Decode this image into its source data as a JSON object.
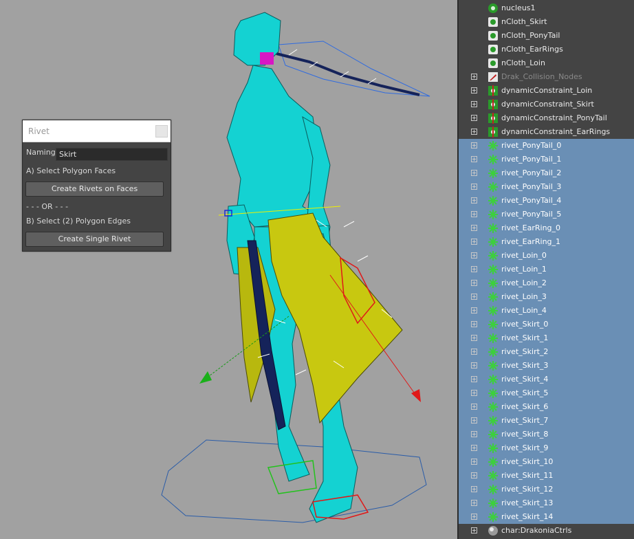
{
  "rivet_dialog": {
    "title": "Rivet",
    "naming_label": "Naming:",
    "naming_value": "Skirt",
    "step_a": "A) Select Polygon Faces",
    "create_on_faces": "Create Rivets on Faces",
    "or_separator": "- - - OR - - -",
    "step_b": "B) Select (2) Polygon Edges",
    "create_single": "Create Single Rivet"
  },
  "outliner": {
    "rows": [
      {
        "label": "nucleus1",
        "icon": "nucleus-icon",
        "expander": false,
        "selected": false,
        "dim": false
      },
      {
        "label": "nCloth_Skirt",
        "icon": "ncloth-icon",
        "expander": false,
        "selected": false,
        "dim": false
      },
      {
        "label": "nCloth_PonyTail",
        "icon": "ncloth-icon",
        "expander": false,
        "selected": false,
        "dim": false
      },
      {
        "label": "nCloth_EarRings",
        "icon": "ncloth-icon",
        "expander": false,
        "selected": false,
        "dim": false
      },
      {
        "label": "nCloth_Loin",
        "icon": "ncloth-icon",
        "expander": false,
        "selected": false,
        "dim": false
      },
      {
        "label": "Drak_Collision_Nodes",
        "icon": "collider-icon",
        "expander": true,
        "selected": false,
        "dim": true
      },
      {
        "label": "dynamicConstraint_Loin",
        "icon": "constraint-icon",
        "expander": true,
        "selected": false,
        "dim": false
      },
      {
        "label": "dynamicConstraint_Skirt",
        "icon": "constraint-icon",
        "expander": true,
        "selected": false,
        "dim": false
      },
      {
        "label": "dynamicConstraint_PonyTail",
        "icon": "constraint-icon",
        "expander": true,
        "selected": false,
        "dim": false
      },
      {
        "label": "dynamicConstraint_EarRings",
        "icon": "constraint-icon",
        "expander": true,
        "selected": false,
        "dim": false
      },
      {
        "label": "rivet_PonyTail_0",
        "icon": "locator-icon",
        "expander": true,
        "selected": true,
        "dim": false
      },
      {
        "label": "rivet_PonyTail_1",
        "icon": "locator-icon",
        "expander": true,
        "selected": true,
        "dim": false
      },
      {
        "label": "rivet_PonyTail_2",
        "icon": "locator-icon",
        "expander": true,
        "selected": true,
        "dim": false
      },
      {
        "label": "rivet_PonyTail_3",
        "icon": "locator-icon",
        "expander": true,
        "selected": true,
        "dim": false
      },
      {
        "label": "rivet_PonyTail_4",
        "icon": "locator-icon",
        "expander": true,
        "selected": true,
        "dim": false
      },
      {
        "label": "rivet_PonyTail_5",
        "icon": "locator-icon",
        "expander": true,
        "selected": true,
        "dim": false
      },
      {
        "label": "rivet_EarRing_0",
        "icon": "locator-icon",
        "expander": true,
        "selected": true,
        "dim": false
      },
      {
        "label": "rivet_EarRing_1",
        "icon": "locator-icon",
        "expander": true,
        "selected": true,
        "dim": false
      },
      {
        "label": "rivet_Loin_0",
        "icon": "locator-icon",
        "expander": true,
        "selected": true,
        "dim": false
      },
      {
        "label": "rivet_Loin_1",
        "icon": "locator-icon",
        "expander": true,
        "selected": true,
        "dim": false
      },
      {
        "label": "rivet_Loin_2",
        "icon": "locator-icon",
        "expander": true,
        "selected": true,
        "dim": false
      },
      {
        "label": "rivet_Loin_3",
        "icon": "locator-icon",
        "expander": true,
        "selected": true,
        "dim": false
      },
      {
        "label": "rivet_Loin_4",
        "icon": "locator-icon",
        "expander": true,
        "selected": true,
        "dim": false
      },
      {
        "label": "rivet_Skirt_0",
        "icon": "locator-icon",
        "expander": true,
        "selected": true,
        "dim": false
      },
      {
        "label": "rivet_Skirt_1",
        "icon": "locator-icon",
        "expander": true,
        "selected": true,
        "dim": false
      },
      {
        "label": "rivet_Skirt_2",
        "icon": "locator-icon",
        "expander": true,
        "selected": true,
        "dim": false
      },
      {
        "label": "rivet_Skirt_3",
        "icon": "locator-icon",
        "expander": true,
        "selected": true,
        "dim": false
      },
      {
        "label": "rivet_Skirt_4",
        "icon": "locator-icon",
        "expander": true,
        "selected": true,
        "dim": false
      },
      {
        "label": "rivet_Skirt_5",
        "icon": "locator-icon",
        "expander": true,
        "selected": true,
        "dim": false
      },
      {
        "label": "rivet_Skirt_6",
        "icon": "locator-icon",
        "expander": true,
        "selected": true,
        "dim": false
      },
      {
        "label": "rivet_Skirt_7",
        "icon": "locator-icon",
        "expander": true,
        "selected": true,
        "dim": false
      },
      {
        "label": "rivet_Skirt_8",
        "icon": "locator-icon",
        "expander": true,
        "selected": true,
        "dim": false
      },
      {
        "label": "rivet_Skirt_9",
        "icon": "locator-icon",
        "expander": true,
        "selected": true,
        "dim": false
      },
      {
        "label": "rivet_Skirt_10",
        "icon": "locator-icon",
        "expander": true,
        "selected": true,
        "dim": false
      },
      {
        "label": "rivet_Skirt_11",
        "icon": "locator-icon",
        "expander": true,
        "selected": true,
        "dim": false
      },
      {
        "label": "rivet_Skirt_12",
        "icon": "locator-icon",
        "expander": true,
        "selected": true,
        "dim": false
      },
      {
        "label": "rivet_Skirt_13",
        "icon": "locator-icon",
        "expander": true,
        "selected": true,
        "dim": false
      },
      {
        "label": "rivet_Skirt_14",
        "icon": "locator-icon",
        "expander": true,
        "selected": true,
        "dim": false
      },
      {
        "label": "char:DrakoniaCtrls",
        "icon": "reference-icon",
        "expander": true,
        "selected": false,
        "dim": false
      }
    ]
  },
  "colors": {
    "viewport_bg": "#a1a1a1",
    "mesh": "#14d2d2",
    "skirt": "#c8c810",
    "selection": "#6a8fb5"
  }
}
